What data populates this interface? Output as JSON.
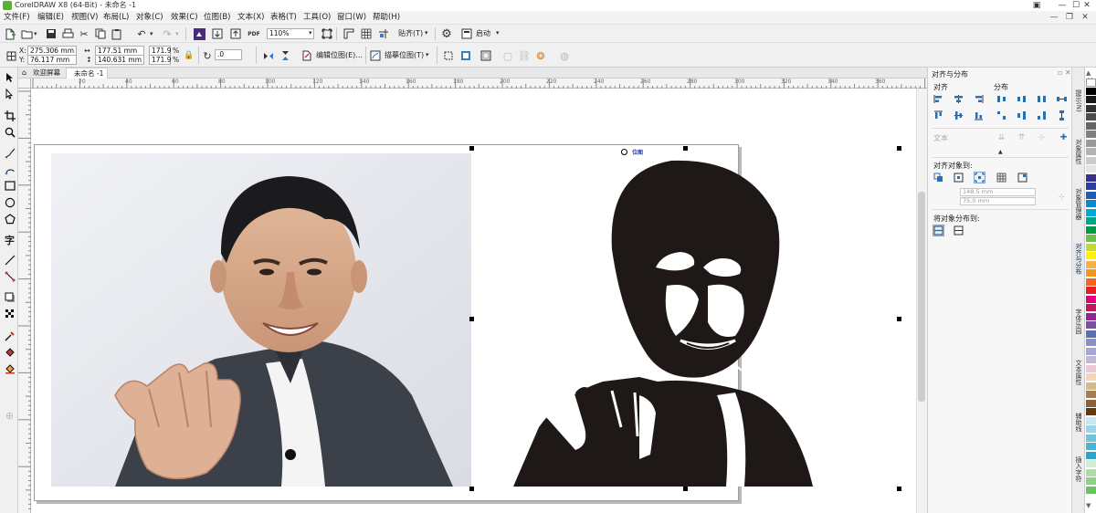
{
  "window": {
    "title": "CorelDRAW X8 (64-Bit) - 未命名 -1",
    "controls": {
      "restore": "▣",
      "minimize": "—",
      "maximize": "☐",
      "close": "✕"
    }
  },
  "menubar": {
    "items": [
      "文件(F)",
      "编辑(E)",
      "视图(V)",
      "布局(L)",
      "对象(C)",
      "效果(C)",
      "位图(B)",
      "文本(X)",
      "表格(T)",
      "工具(O)",
      "窗口(W)",
      "帮助(H)"
    ],
    "mdi_controls": {
      "minimize": "—",
      "restore": "❐",
      "close": "✕"
    }
  },
  "toolbar": {
    "zoom_value": "110%",
    "snap_label": "贴齐(T)",
    "launch_label": "启动"
  },
  "propbar": {
    "x_label": "X:",
    "x_value": "275.306 mm",
    "y_label": "Y:",
    "y_value": "76.117 mm",
    "w_value": "177.51 mm",
    "h_value": "140.631 mm",
    "scale_w": "171.9",
    "scale_h": "171.9",
    "pct": "%",
    "rotation": ".0",
    "edit_bitmap": "编辑位图(E)...",
    "trace_bitmap": "描摹位图(T)"
  },
  "doc_tabs": {
    "welcome": "欢迎屏幕",
    "document": "未命名 -1"
  },
  "ruler": {
    "h_ticks": [
      "20",
      "40",
      "60",
      "80",
      "100",
      "120",
      "140",
      "160",
      "180",
      "200",
      "220",
      "240",
      "260",
      "280",
      "300",
      "320",
      "340",
      "360"
    ]
  },
  "docker": {
    "title": "对齐与分布",
    "align_label": "对齐",
    "distribute_label": "分布",
    "text_label": "文本",
    "align_to_label": "对齐对象到:",
    "x_field": "148.5 mm",
    "y_field": "75.0 mm",
    "distribute_to_label": "将对象分布到:",
    "collapse_arrow": "▲"
  },
  "vertical_tabs": [
    "提示(N)",
    "对象属性",
    "对象管理器",
    "对齐与分布",
    "字体乐园",
    "文本属性",
    "辅助线",
    "插入字符"
  ],
  "palette": {
    "colors": [
      "#ffffff",
      "#000000",
      "#1a1a1a",
      "#333333",
      "#4d4d4d",
      "#666666",
      "#808080",
      "#999999",
      "#b3b3b3",
      "#cccccc",
      "#e5e5e5",
      "#3d2f86",
      "#2b3fa0",
      "#1f5cb8",
      "#0b89cf",
      "#00a7d8",
      "#00a88a",
      "#009a44",
      "#6dbe45",
      "#c4d82e",
      "#fff200",
      "#fbb040",
      "#f7941d",
      "#f26522",
      "#ed1c24",
      "#e6007e",
      "#c2185b",
      "#92278f",
      "#7b4ea3",
      "#5b6eb5",
      "#8a8fc6",
      "#a6a8d3",
      "#c5b5d9",
      "#f1c6d4",
      "#f9d5b8",
      "#d7b98e",
      "#a67c52",
      "#8c6239",
      "#603813",
      "#c7e8f3",
      "#9ad5e8",
      "#6fc3dc",
      "#4bb4d2",
      "#2aa6cb",
      "#d3ebd0",
      "#b1dca9",
      "#8fcf86",
      "#6dc264"
    ]
  },
  "selection_tag": "位图"
}
